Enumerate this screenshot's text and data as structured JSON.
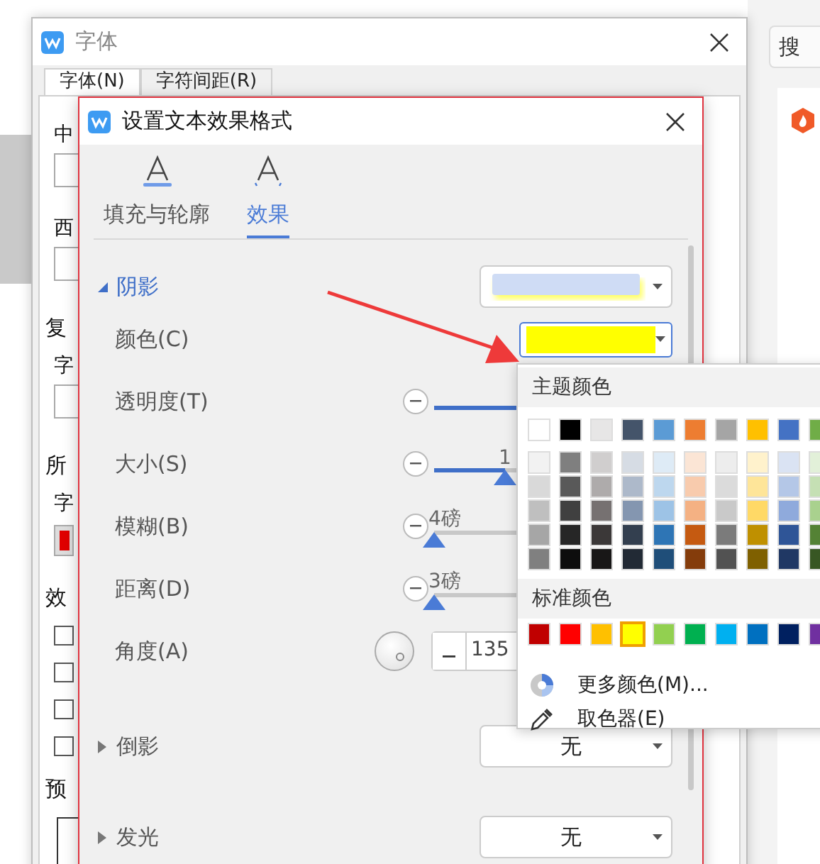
{
  "background_page": {
    "search_button": "搜"
  },
  "font_dialog": {
    "title": "字体",
    "tabs": [
      {
        "label": "字体(N)",
        "selected": true
      },
      {
        "label": "字符间距(R)",
        "selected": false
      }
    ],
    "items": [
      {
        "kind": "label",
        "text": "中"
      },
      {
        "kind": "field"
      },
      {
        "kind": "label",
        "text": "西"
      },
      {
        "kind": "field"
      },
      {
        "kind": "heading",
        "text": "复"
      },
      {
        "kind": "label",
        "text": "字"
      },
      {
        "kind": "field"
      },
      {
        "kind": "heading",
        "text": "所"
      },
      {
        "kind": "label",
        "text": "字"
      },
      {
        "kind": "swatch",
        "color": "#e00000"
      },
      {
        "kind": "heading",
        "text": "效"
      },
      {
        "kind": "checkbox",
        "checked": false
      },
      {
        "kind": "checkbox",
        "checked": false
      },
      {
        "kind": "checkbox",
        "checked": false
      },
      {
        "kind": "checkbox",
        "checked": false
      },
      {
        "kind": "heading",
        "text": "预"
      },
      {
        "kind": "preview"
      }
    ]
  },
  "effects_dialog": {
    "title": "设置文本效果格式",
    "tabs": [
      {
        "label": "填充与轮廓",
        "selected": false
      },
      {
        "label": "效果",
        "selected": true
      }
    ],
    "sections": [
      {
        "title": "阴影",
        "expanded": true,
        "rows": [
          {
            "kind": "color",
            "label": "颜色(C)",
            "color": "#ffff00"
          },
          {
            "kind": "slider",
            "label": "透明度(T)",
            "level": 0.5
          },
          {
            "kind": "slider",
            "label": "大小(S)",
            "level": 0.3,
            "reading": "1"
          },
          {
            "kind": "slider",
            "label": "模糊(B)",
            "level": 0,
            "reading": "4磅"
          },
          {
            "kind": "slider",
            "label": "距离(D)",
            "level": 0,
            "reading": "3磅"
          },
          {
            "kind": "angle",
            "label": "角度(A)",
            "value": "135"
          }
        ]
      },
      {
        "title": "倒影",
        "expanded": false,
        "value": "无"
      },
      {
        "title": "发光",
        "expanded": false,
        "value": "无"
      }
    ]
  },
  "color_popup": {
    "theme_title": "主题颜色",
    "theme_colors": [
      {
        "color": "#ffffff",
        "selected": false
      },
      {
        "color": "#000000",
        "selected": false
      },
      {
        "color": "#e7e6e6",
        "selected": false
      },
      {
        "color": "#44546a",
        "selected": false
      },
      {
        "color": "#5b9bd5",
        "selected": false
      },
      {
        "color": "#ed7d31",
        "selected": false
      },
      {
        "color": "#a5a5a5",
        "selected": false
      },
      {
        "color": "#ffc000",
        "selected": false
      },
      {
        "color": "#4472c4",
        "selected": false
      },
      {
        "color": "#70ad47",
        "selected": false
      }
    ],
    "theme_shades": [
      [
        {
          "color": "#f2f2f2",
          "selected": false
        },
        {
          "color": "#7f7f7f",
          "selected": false
        },
        {
          "color": "#d0cece",
          "selected": false
        },
        {
          "color": "#d6dce4",
          "selected": false
        },
        {
          "color": "#deebf6",
          "selected": false
        },
        {
          "color": "#fbe5d5",
          "selected": false
        },
        {
          "color": "#ededed",
          "selected": false
        },
        {
          "color": "#fff2cc",
          "selected": false
        },
        {
          "color": "#dae3f3",
          "selected": false
        },
        {
          "color": "#e2f0d9",
          "selected": false
        }
      ],
      [
        {
          "color": "#d9d9d9",
          "selected": false
        },
        {
          "color": "#595959",
          "selected": false
        },
        {
          "color": "#aeabab",
          "selected": false
        },
        {
          "color": "#adb9ca",
          "selected": false
        },
        {
          "color": "#bdd7ee",
          "selected": false
        },
        {
          "color": "#f8cbad",
          "selected": false
        },
        {
          "color": "#dbdbdb",
          "selected": false
        },
        {
          "color": "#fee599",
          "selected": false
        },
        {
          "color": "#b4c7e7",
          "selected": false
        },
        {
          "color": "#c5e0b4",
          "selected": false
        }
      ],
      [
        {
          "color": "#bfbfbf",
          "selected": false
        },
        {
          "color": "#404040",
          "selected": false
        },
        {
          "color": "#767171",
          "selected": false
        },
        {
          "color": "#8496b0",
          "selected": false
        },
        {
          "color": "#9dc3e6",
          "selected": false
        },
        {
          "color": "#f4b183",
          "selected": false
        },
        {
          "color": "#c9c9c9",
          "selected": false
        },
        {
          "color": "#ffd966",
          "selected": false
        },
        {
          "color": "#8faadc",
          "selected": false
        },
        {
          "color": "#a9d18e",
          "selected": false
        }
      ],
      [
        {
          "color": "#a6a6a6",
          "selected": false
        },
        {
          "color": "#262626",
          "selected": false
        },
        {
          "color": "#3b3838",
          "selected": false
        },
        {
          "color": "#333f4f",
          "selected": false
        },
        {
          "color": "#2e75b5",
          "selected": false
        },
        {
          "color": "#c55a11",
          "selected": false
        },
        {
          "color": "#7b7b7b",
          "selected": false
        },
        {
          "color": "#bf9000",
          "selected": false
        },
        {
          "color": "#2f5597",
          "selected": false
        },
        {
          "color": "#548235",
          "selected": false
        }
      ],
      [
        {
          "color": "#808080",
          "selected": false
        },
        {
          "color": "#0d0d0d",
          "selected": false
        },
        {
          "color": "#181717",
          "selected": false
        },
        {
          "color": "#222a35",
          "selected": false
        },
        {
          "color": "#1f4e79",
          "selected": false
        },
        {
          "color": "#843c0b",
          "selected": false
        },
        {
          "color": "#525252",
          "selected": false
        },
        {
          "color": "#7f6000",
          "selected": false
        },
        {
          "color": "#203864",
          "selected": false
        },
        {
          "color": "#385723",
          "selected": false
        }
      ]
    ],
    "standard_title": "标准颜色",
    "standard_colors": [
      {
        "color": "#c00000",
        "selected": false
      },
      {
        "color": "#ff0000",
        "selected": false
      },
      {
        "color": "#ffc000",
        "selected": false
      },
      {
        "color": "#ffff00",
        "selected": true
      },
      {
        "color": "#92d050",
        "selected": false
      },
      {
        "color": "#00b050",
        "selected": false
      },
      {
        "color": "#00b0f0",
        "selected": false
      },
      {
        "color": "#0070c0",
        "selected": false
      },
      {
        "color": "#002060",
        "selected": false
      },
      {
        "color": "#7030a0",
        "selected": false
      }
    ],
    "menu": [
      {
        "kind": "palette",
        "label": "更多颜色(M)..."
      },
      {
        "kind": "picker",
        "label": "取色器(E)"
      }
    ]
  }
}
